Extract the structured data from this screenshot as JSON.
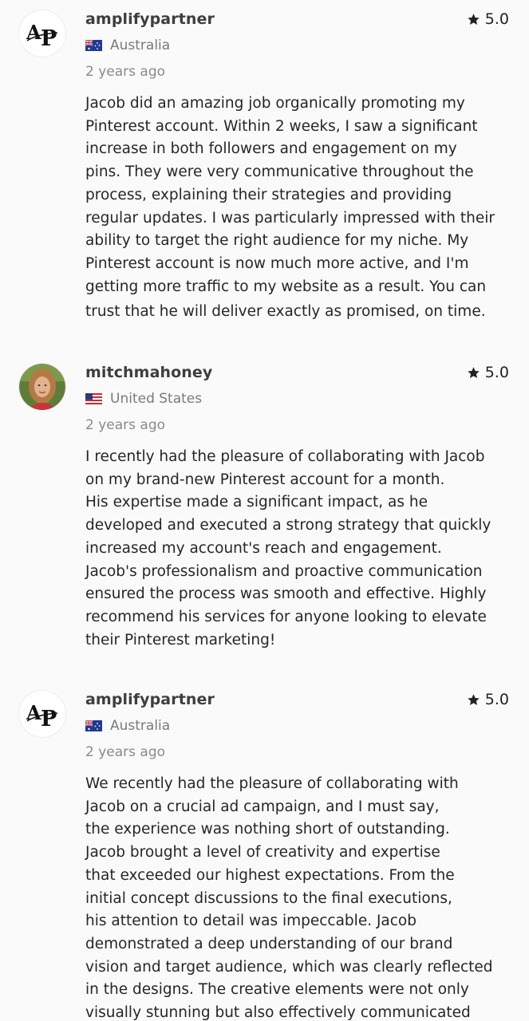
{
  "reviews": [
    {
      "username": "amplifypartner",
      "rating": "5.0",
      "country": "Australia",
      "flag": "flag-australia",
      "time": "2 years ago",
      "avatar": "ap-logo-avatar",
      "avatar_text": "AP",
      "lines": [
        "Jacob did an amazing job organically promoting my",
        "Pinterest account. Within 2 weeks, I saw a significant",
        "increase in both followers and engagement on my",
        "pins. They were very communicative throughout the",
        "process, explaining their strategies and providing",
        "regular updates. I was particularly impressed with their",
        "ability to target the right audience for my niche. My",
        "Pinterest account is now much more active, and I'm",
        "getting more traffic to my website as a result. You can",
        "trust that he will deliver exactly as promised, on time."
      ]
    },
    {
      "username": "mitchmahoney",
      "rating": "5.0",
      "country": "United States",
      "flag": "flag-united-states",
      "time": "2 years ago",
      "avatar": "user-photo-avatar",
      "lines": [
        "I recently had the pleasure of collaborating with Jacob",
        "on my brand-new Pinterest account for a month.",
        "His expertise made a significant impact, as he",
        "developed and executed a strong strategy that quickly",
        "increased my account's reach and engagement.",
        "Jacob's professionalism and proactive communication",
        "ensured the process was smooth and effective. Highly",
        "recommend his services for anyone looking to elevate",
        "their Pinterest marketing!"
      ]
    },
    {
      "username": "amplifypartner",
      "rating": "5.0",
      "country": "Australia",
      "flag": "flag-australia",
      "time": "2 years ago",
      "avatar": "ap-logo-avatar",
      "avatar_text": "AP",
      "lines": [
        "We recently had the pleasure of collaborating with",
        "Jacob on a crucial ad campaign, and I must say,",
        "the experience was nothing short of outstanding.",
        "Jacob brought a level of creativity and expertise",
        "that exceeded our highest expectations. From the",
        "initial concept discussions to the final executions,",
        "his attention to detail was impeccable. Jacob",
        "demonstrated a deep understanding of our brand",
        "vision and target audience, which was clearly reflected",
        "in the designs. The creative elements were not only",
        "visually stunning but also effectively communicated"
      ]
    }
  ]
}
